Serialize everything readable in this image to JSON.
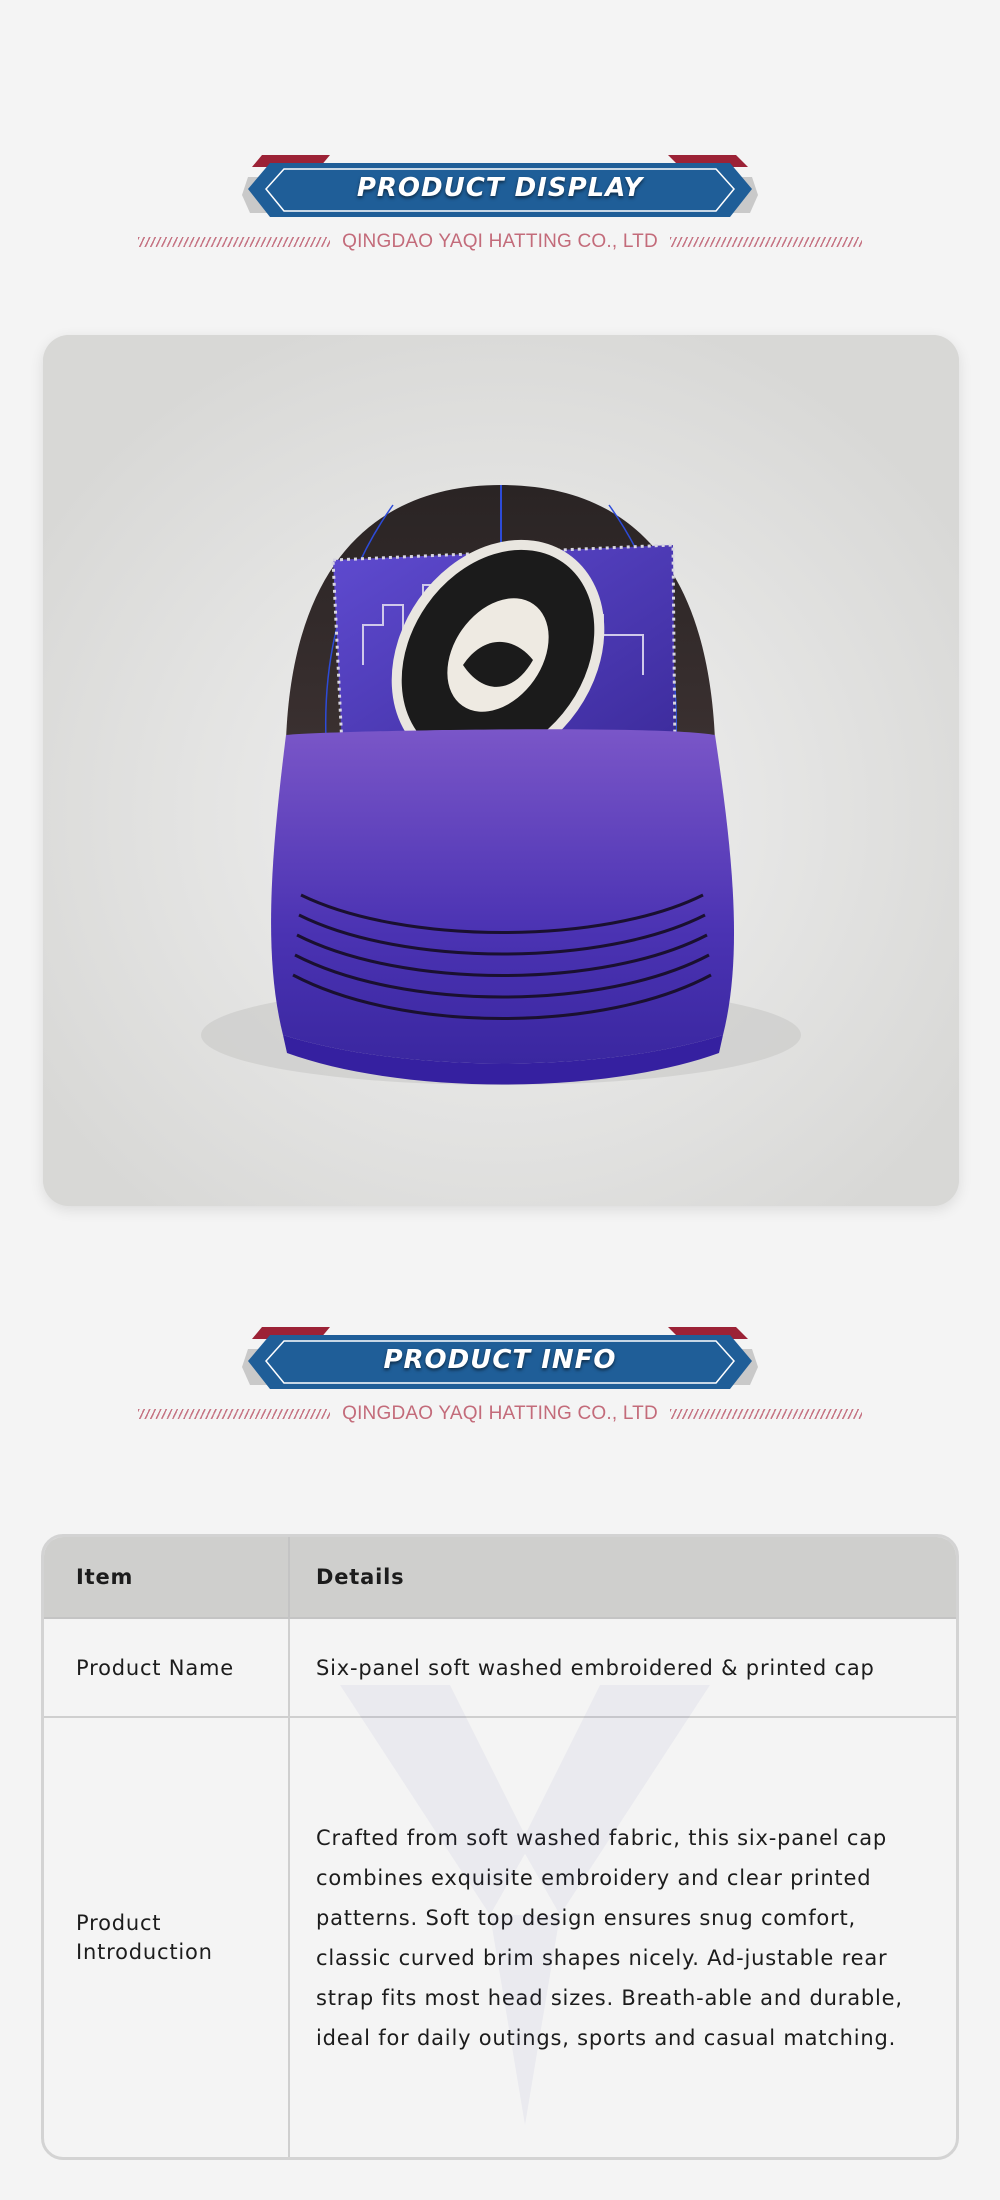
{
  "sections": {
    "display": {
      "title": "PRODUCT DISPLAY",
      "company": "QINGDAO YAQI HATTING CO., LTD"
    },
    "info": {
      "title": "PRODUCT INFO",
      "company": "QINGDAO YAQI HATTING CO., LTD"
    }
  },
  "table": {
    "header": {
      "item": "Item",
      "details": "Details"
    },
    "rows": [
      {
        "item": "Product Name",
        "details": "Six-panel soft washed embroidered & printed cap"
      },
      {
        "item": "Product Introduction",
        "details": "Crafted from soft washed fabric, this six-panel cap combines exquisite embroidery and clear printed patterns. Soft top design ensures snug comfort, classic curved brim shapes nicely. Ad-justable rear strap fits most head sizes. Breath-able and durable, ideal for daily outings, sports and casual matching."
      }
    ]
  },
  "colors": {
    "banner_blue": "#1f5e98",
    "banner_red": "#9c2236",
    "banner_grey": "#c9c9c9",
    "accent_pink": "#c36b7a",
    "cap_purple": "#5a3cc0",
    "cap_crown": "#2a2626"
  },
  "icons": {
    "product_photo": "cap-image",
    "watermark": "logo-watermark"
  }
}
